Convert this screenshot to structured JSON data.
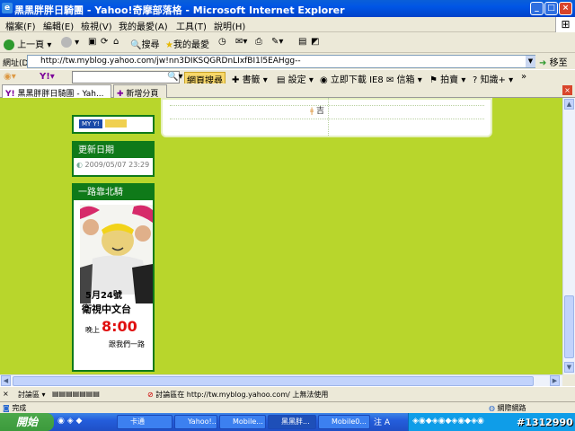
{
  "window": {
    "title": "黑黑胖胖日騎團 - Yahoo!奇摩部落格 - Microsoft Internet Explorer"
  },
  "menu": [
    "檔案(F)",
    "編輯(E)",
    "檢視(V)",
    "我的最愛(A)",
    "工具(T)",
    "說明(H)"
  ],
  "toolbar": {
    "back": "上一頁",
    "search": "搜尋",
    "favorites": "我的最愛"
  },
  "address": {
    "label": "網址(D)",
    "url": "http://tw.myblog.yahoo.com/jw!nn3DIKSQGRDnLIxfBI1l5EAHgg--",
    "go": "移至"
  },
  "yahoo_bar": {
    "web_search": "網頁搜尋",
    "bookmarks": "書籤",
    "settings": "設定",
    "ie8": "立即下載 IE8",
    "mail": "信箱",
    "auction": "拍賣",
    "knowledge": "知識+"
  },
  "tabs": {
    "active": "黑黑胖胖日騎團 - Yah...",
    "new_tab": "新增分頁"
  },
  "page": {
    "myyahoo": "MY Y!",
    "update_title": "更新日期",
    "update_date": "2009/05/07 23:29",
    "north_title": "一路靠北騎",
    "poster_date": "5月24號",
    "poster_channel": "衛視中文台",
    "poster_evening": "晚上",
    "poster_time": "8:00",
    "poster_follow": "跟我們一路",
    "stats_label": "吉"
  },
  "findbar": {
    "label": "討論區",
    "message": "討論區在 http://tw.myblog.yahoo.com/ 上無法使用"
  },
  "status": {
    "left": "完成",
    "zone": "網際網路"
  },
  "taskbar": {
    "start": "開始",
    "buttons": [
      "卡通",
      "Yahoo!...",
      "Mobile...",
      "黑黑胖...",
      "Mobile0..."
    ],
    "watermark": "#1312990"
  }
}
